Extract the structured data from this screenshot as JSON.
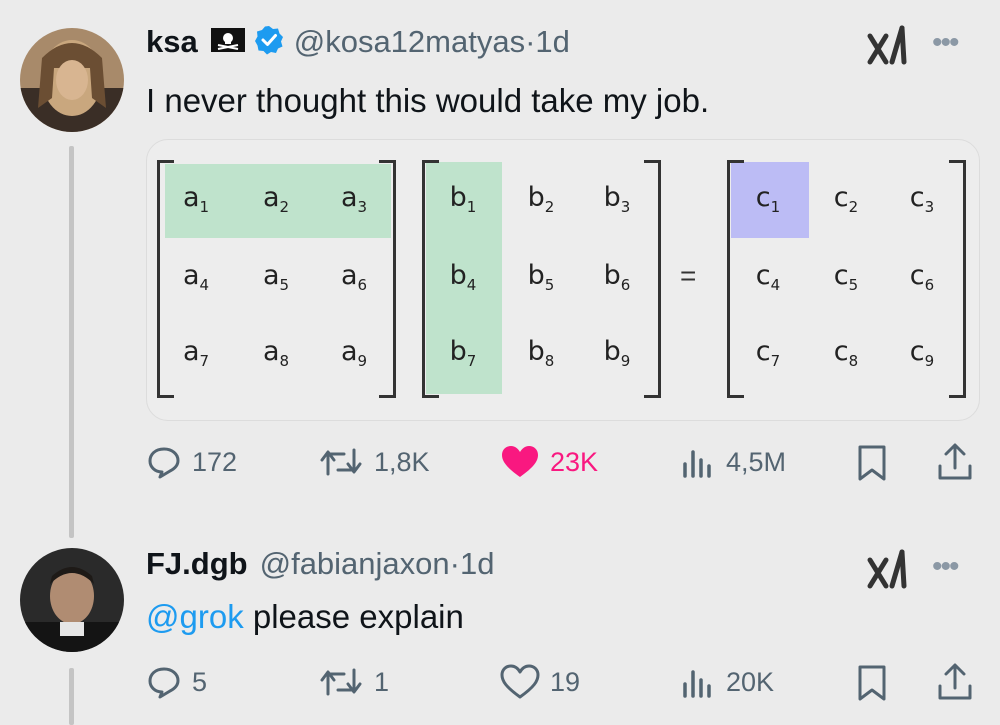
{
  "tweet": {
    "display_name": "ksa",
    "handle": "@kosa12matyas",
    "sep": " · ",
    "time": "1d",
    "text": "I never thought this would take my job.",
    "matrix_a": [
      "a1",
      "a2",
      "a3",
      "a4",
      "a5",
      "a6",
      "a7",
      "a8",
      "a9"
    ],
    "matrix_b": [
      "b1",
      "b2",
      "b3",
      "b4",
      "b5",
      "b6",
      "b7",
      "b8",
      "b9"
    ],
    "matrix_c": [
      "c1",
      "c2",
      "c3",
      "c4",
      "c5",
      "c6",
      "c7",
      "c8",
      "c9"
    ],
    "equals": "=",
    "stats": {
      "replies": "172",
      "reposts": "1,8K",
      "likes": "23K",
      "views": "4,5M"
    }
  },
  "reply": {
    "display_name": "FJ.dgb",
    "handle": "@fabianjaxon",
    "sep": " · ",
    "time": "1d",
    "mention": "@grok",
    "text": " please explain",
    "stats": {
      "replies": "5",
      "reposts": "1",
      "likes": "19",
      "views": "20K"
    }
  },
  "colors": {
    "row_highlight": "#bfe3cc",
    "col_highlight": "#bfe3cc",
    "cell_highlight": "#bcbcf5",
    "like_active": "#f91880",
    "verified": "#1d9bf0"
  }
}
